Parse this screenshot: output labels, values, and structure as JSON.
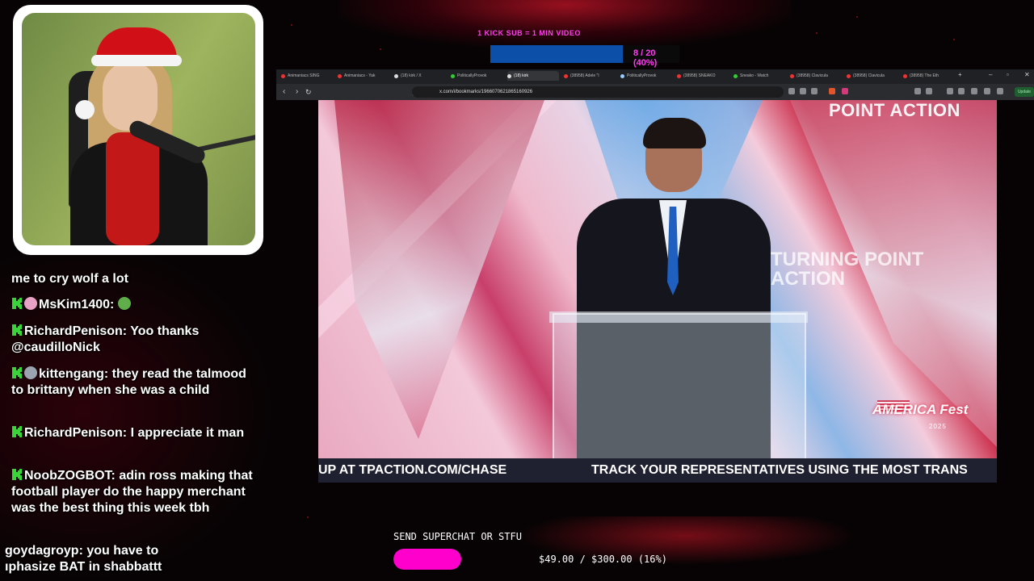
{
  "colors": {
    "accent_magenta": "#ff3df0",
    "goal_blue": "#0c4fa8",
    "superchat_pink": "#ff00cc",
    "badge_green": "#3ad43a"
  },
  "top_goal": {
    "title": "1 KICK SUB = 1 MIN VIDEO",
    "progress_text": "8 / 20 (40%)",
    "progress_fraction": 0.4
  },
  "chat": {
    "partial_top": "me to cry wolf a lot",
    "messages": [
      {
        "name": "MsKim1400:",
        "text": "",
        "emote": "pepe-emote"
      },
      {
        "name": "RichardPenison:",
        "text": "Yoo thanks @caudilloNick"
      },
      {
        "name": "kittengang:",
        "text": "they read the talmood to brittany when she was a child"
      },
      {
        "name": "RichardPenison:",
        "text": "I appreciate it man"
      },
      {
        "name": "NoobZOGBOT:",
        "text": "adin ross making that football player do the happy merchant was the best thing this week tbh"
      },
      {
        "name": "goydagroyp:",
        "text": "you have to"
      },
      {
        "name": "",
        "text": "ıphasize BAT in shabbattt"
      }
    ]
  },
  "browser": {
    "tabs": [
      {
        "label": "Animaniacs SING",
        "color": "#e33"
      },
      {
        "label": "Animaniacs - Yak",
        "color": "#e33"
      },
      {
        "label": "(18) kirk / X",
        "color": "#ddd"
      },
      {
        "label": "PoliticallyProvok",
        "color": "#3c3"
      },
      {
        "label": "(18) kirk",
        "color": "#ddd"
      },
      {
        "label": "(38958) Adele \"I",
        "color": "#e33"
      },
      {
        "label": "PoliticallyProvok",
        "color": "#9cf"
      },
      {
        "label": "(38958) SNEAKO",
        "color": "#e33"
      },
      {
        "label": "Sneako - Watch",
        "color": "#3c3"
      },
      {
        "label": "(38958) Clavicula",
        "color": "#e33"
      },
      {
        "label": "(38958) Clavicula",
        "color": "#e33"
      },
      {
        "label": "(38958) The Eth",
        "color": "#e33"
      }
    ],
    "url": "x.com/i/bookmarks/1966070621865160926",
    "update_label": "Update"
  },
  "video": {
    "logo_text": "POINT ACTION",
    "backdrop_text": "TURNING POINT ACTION",
    "event_logo": "AMERICA Fest",
    "event_year": "2025",
    "ticker_left": "UP AT TPACTION.COM/CHASE",
    "ticker_right": "TRACK YOUR REPRESENTATIVES USING THE MOST TRANS"
  },
  "superchat_goal": {
    "title": "SEND SUPERCHAT OR STFU",
    "amount_text": "$49.00 / $300.00 (16%)",
    "progress_fraction": 0.16
  }
}
